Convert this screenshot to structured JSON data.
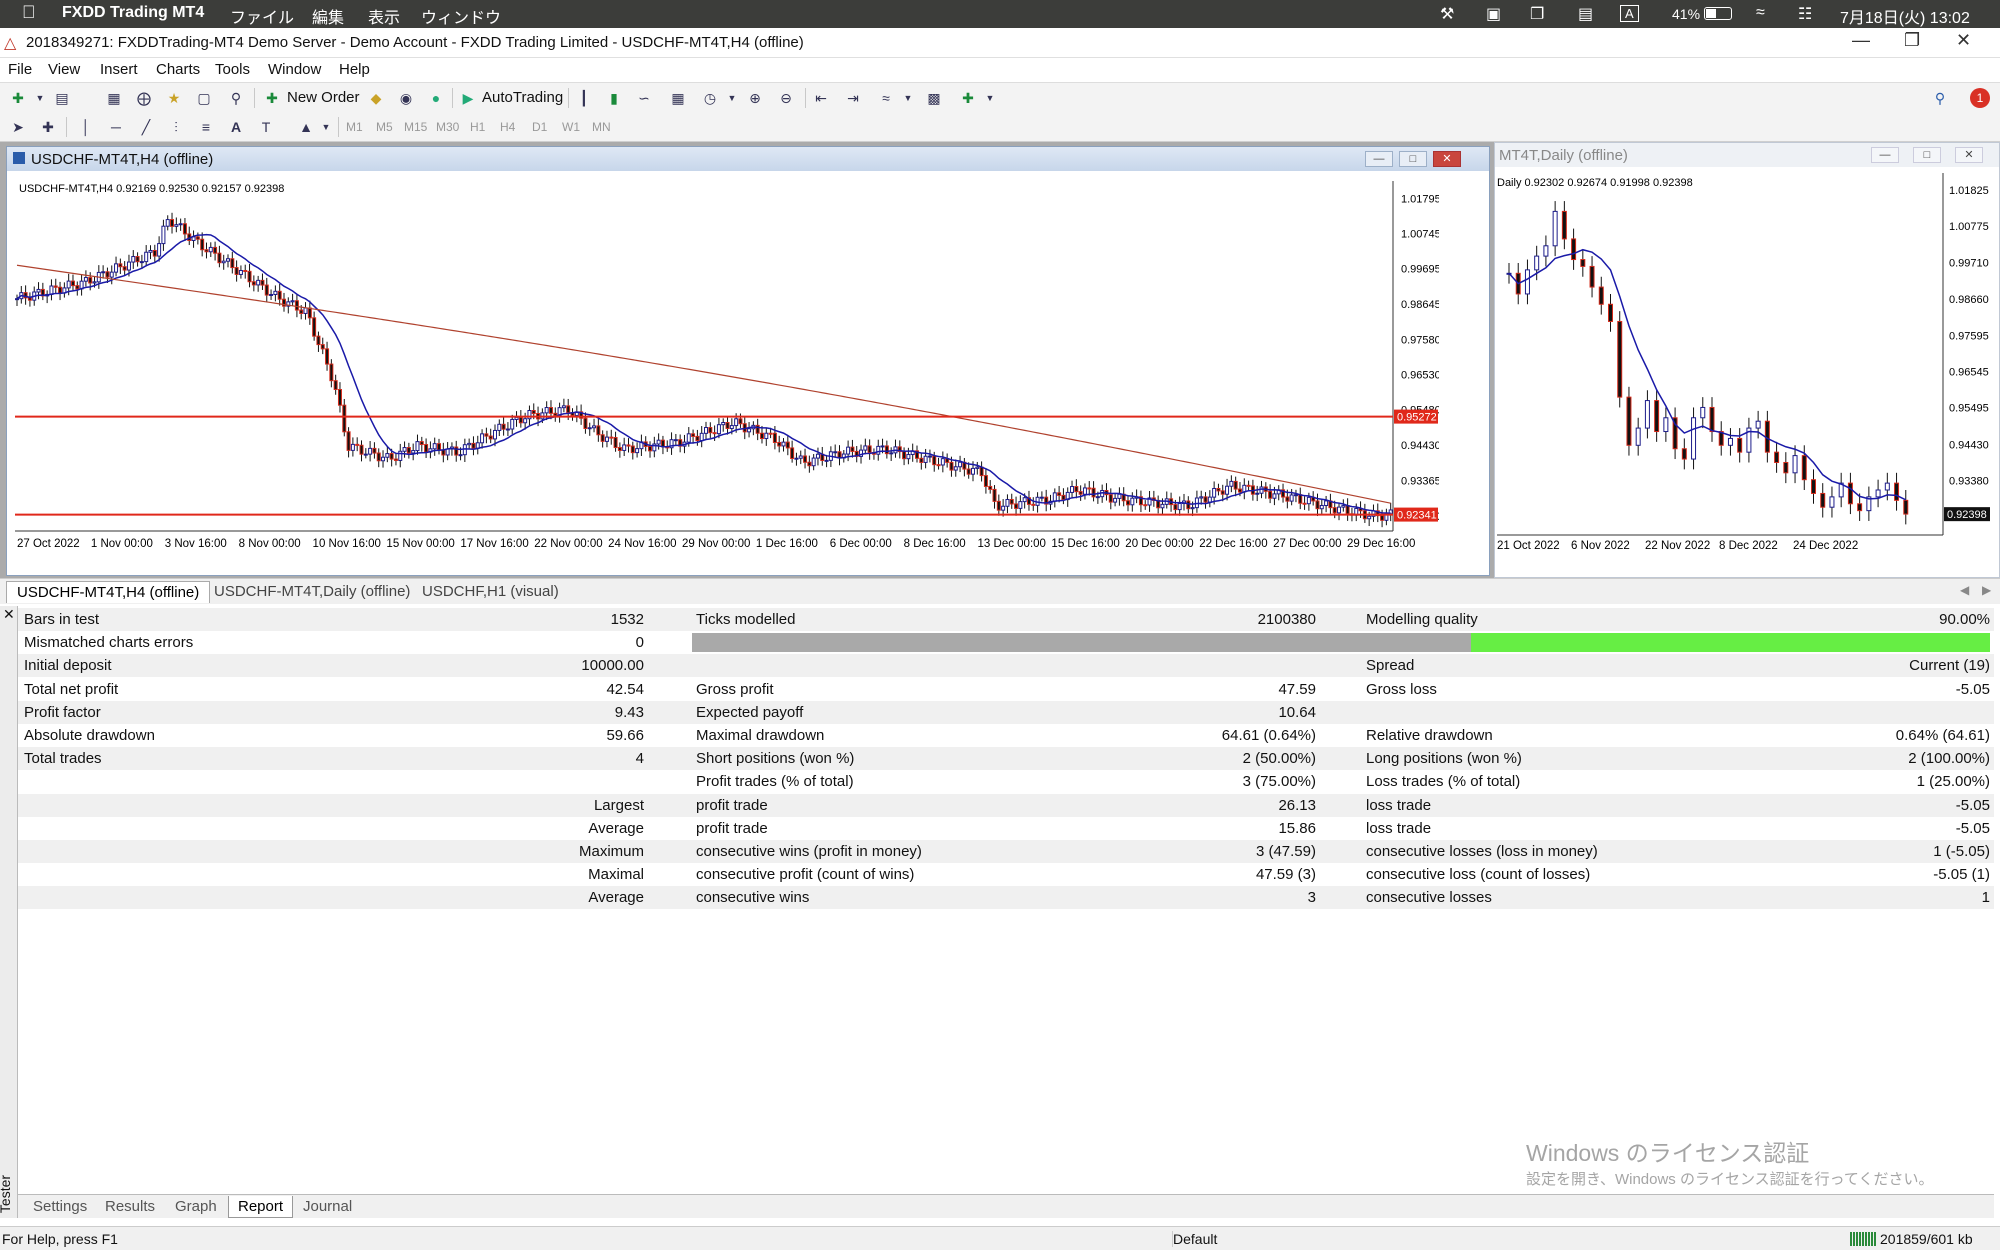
{
  "macbar": {
    "app": "FXDD Trading MT4",
    "menus": [
      "ファイル",
      "編集",
      "表示",
      "ウィンドウ"
    ],
    "battery": "41%",
    "datetime": "7月18日(火)  13:02"
  },
  "window": {
    "title": "2018349271: FXDDTrading-MT4 Demo Server - Demo Account - FXDD Trading Limited - USDCHF-MT4T,H4 (offline)"
  },
  "menu": [
    "File",
    "View",
    "Insert",
    "Charts",
    "Tools",
    "Window",
    "Help"
  ],
  "toolbar": {
    "new_order": "New Order",
    "autotrading": "AutoTrading",
    "timeframes": [
      "M1",
      "M5",
      "M15",
      "M30",
      "H1",
      "H4",
      "D1",
      "W1",
      "MN"
    ],
    "notif_count": "1"
  },
  "chart_h4": {
    "title": "USDCHF-MT4T,H4 (offline)",
    "info": "USDCHF-MT4T,H4  0.92169 0.92530 0.92157 0.92398",
    "price_labels": [
      "1.01795",
      "1.00745",
      "0.99695",
      "0.98645",
      "0.97580",
      "0.96530",
      "0.95480",
      "0.94430",
      "0.93365",
      "0.92300"
    ],
    "hline_labels": [
      "0.95272",
      "0.92341"
    ],
    "time_labels": [
      "27 Oct 2022",
      "1 Nov 00:00",
      "3 Nov 16:00",
      "8 Nov 00:00",
      "10 Nov 16:00",
      "15 Nov 00:00",
      "17 Nov 16:00",
      "22 Nov 00:00",
      "24 Nov 16:00",
      "29 Nov 00:00",
      "1 Dec 16:00",
      "6 Dec 00:00",
      "8 Dec 16:00",
      "13 Dec 00:00",
      "15 Dec 16:00",
      "20 Dec 00:00",
      "22 Dec 16:00",
      "27 Dec 00:00",
      "29 Dec 16:00"
    ]
  },
  "chart_daily": {
    "title": "MT4T,Daily (offline)",
    "info": "Daily  0.92302 0.92674 0.91998 0.92398",
    "price_labels": [
      "1.01825",
      "1.00775",
      "0.99710",
      "0.98660",
      "0.97595",
      "0.96545",
      "0.95495",
      "0.94430",
      "0.93380"
    ],
    "current_price": "0.92398",
    "time_labels": [
      "21 Oct 2022",
      "6 Nov 2022",
      "22 Nov 2022",
      "8 Dec 2022",
      "24 Dec 2022"
    ]
  },
  "chart_tabs": [
    "USDCHF-MT4T,H4 (offline)",
    "USDCHF-MT4T,Daily (offline)",
    "USDCHF,H1 (visual)"
  ],
  "report": {
    "rows": [
      {
        "a": "Bars in test",
        "av": "1532",
        "b": "Ticks modelled",
        "bv": "2100380",
        "c": "Modelling quality",
        "cv": "90.00%"
      },
      {
        "a": "Mismatched charts errors",
        "av": "0",
        "quality_bar": 0.9
      },
      {
        "a": "Initial deposit",
        "av": "10000.00",
        "c": "Spread",
        "cv": "Current (19)"
      },
      {
        "a": "Total net profit",
        "av": "42.54",
        "b": "Gross profit",
        "bv": "47.59",
        "c": "Gross loss",
        "cv": "-5.05"
      },
      {
        "a": "Profit factor",
        "av": "9.43",
        "b": "Expected payoff",
        "bv": "10.64"
      },
      {
        "a": "Absolute drawdown",
        "av": "59.66",
        "b": "Maximal drawdown",
        "bv": "64.61 (0.64%)",
        "c": "Relative drawdown",
        "cv": "0.64% (64.61)"
      },
      {
        "a": "Total trades",
        "av": "4",
        "b": "Short positions (won %)",
        "bv": "2 (50.00%)",
        "c": "Long positions (won %)",
        "cv": "2 (100.00%)"
      },
      {
        "b": "Profit trades (% of total)",
        "bv": "3 (75.00%)",
        "c": "Loss trades (% of total)",
        "cv": "1 (25.00%)"
      },
      {
        "av": "Largest",
        "b": "profit trade",
        "bv": "26.13",
        "c": "loss trade",
        "cv": "-5.05"
      },
      {
        "av": "Average",
        "b": "profit trade",
        "bv": "15.86",
        "c": "loss trade",
        "cv": "-5.05"
      },
      {
        "av": "Maximum",
        "b": "consecutive wins (profit in money)",
        "bv": "3 (47.59)",
        "c": "consecutive losses (loss in money)",
        "cv": "1 (-5.05)"
      },
      {
        "av": "Maximal",
        "b": "consecutive profit (count of wins)",
        "bv": "47.59 (3)",
        "c": "consecutive loss (count of losses)",
        "cv": "-5.05 (1)"
      },
      {
        "av": "Average",
        "b": "consecutive wins",
        "bv": "3",
        "c": "consecutive losses",
        "cv": "1"
      }
    ]
  },
  "watermark": {
    "title": "Windows のライセンス認証",
    "sub": "設定を開き、Windows のライセンス認証を行ってください。"
  },
  "bottom_tabs": [
    "Settings",
    "Results",
    "Graph",
    "Report",
    "Journal"
  ],
  "tester_label": "Tester",
  "status": {
    "help": "For Help, press F1",
    "profile": "Default",
    "traffic": "201859/601 kb"
  }
}
